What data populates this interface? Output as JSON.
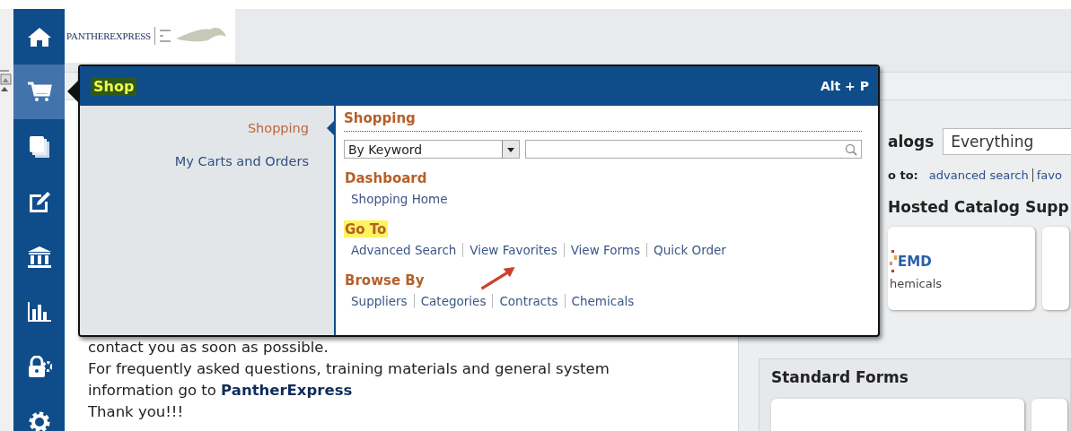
{
  "sidebar": {
    "items": [
      {
        "kind": "home",
        "selected": false
      },
      {
        "kind": "cart",
        "selected": true
      },
      {
        "kind": "documents",
        "selected": false
      },
      {
        "kind": "edit",
        "selected": false
      },
      {
        "kind": "bank",
        "selected": false
      },
      {
        "kind": "chart",
        "selected": false
      },
      {
        "kind": "lock",
        "selected": false
      },
      {
        "kind": "gear",
        "selected": false
      }
    ]
  },
  "header": {
    "logo_text": "PANTHEREXPRESS"
  },
  "flyout": {
    "title": "Shop",
    "title_highlighted": true,
    "shortcut": "Alt + P",
    "menu": [
      {
        "label": "Shopping",
        "selected": true
      },
      {
        "label": "My Carts and Orders",
        "selected": false
      }
    ],
    "section_title": "Shopping",
    "search": {
      "mode": "By Keyword"
    },
    "groups": [
      {
        "title": "Dashboard",
        "highlighted": false,
        "links": [
          "Shopping Home"
        ]
      },
      {
        "title": "Go To",
        "highlighted": true,
        "links": [
          "Advanced Search",
          "View Favorites",
          "View Forms",
          "Quick Order"
        ]
      },
      {
        "title": "Browse By",
        "highlighted": false,
        "links": [
          "Suppliers",
          "Categories",
          "Contracts",
          "Chemicals"
        ]
      }
    ]
  },
  "message": {
    "paragraphs": [
      "contact you as soon as possible.",
      "For frequently asked questions, training materials and general system information go to **PantherExpress**",
      "Thank you!!!"
    ]
  },
  "right_panel": {
    "catalogs_label": "alogs",
    "catalog_select": "Everything",
    "goto_label": "o to:",
    "goto_links": [
      "advanced search",
      "favo"
    ],
    "hosted_title": "Hosted Catalog Supp",
    "cards": [
      {
        "kind": "logo",
        "logo": "EMD",
        "caption": "hemicals"
      },
      {
        "kind": "blank"
      }
    ],
    "forms_title": "Standard Forms"
  }
}
